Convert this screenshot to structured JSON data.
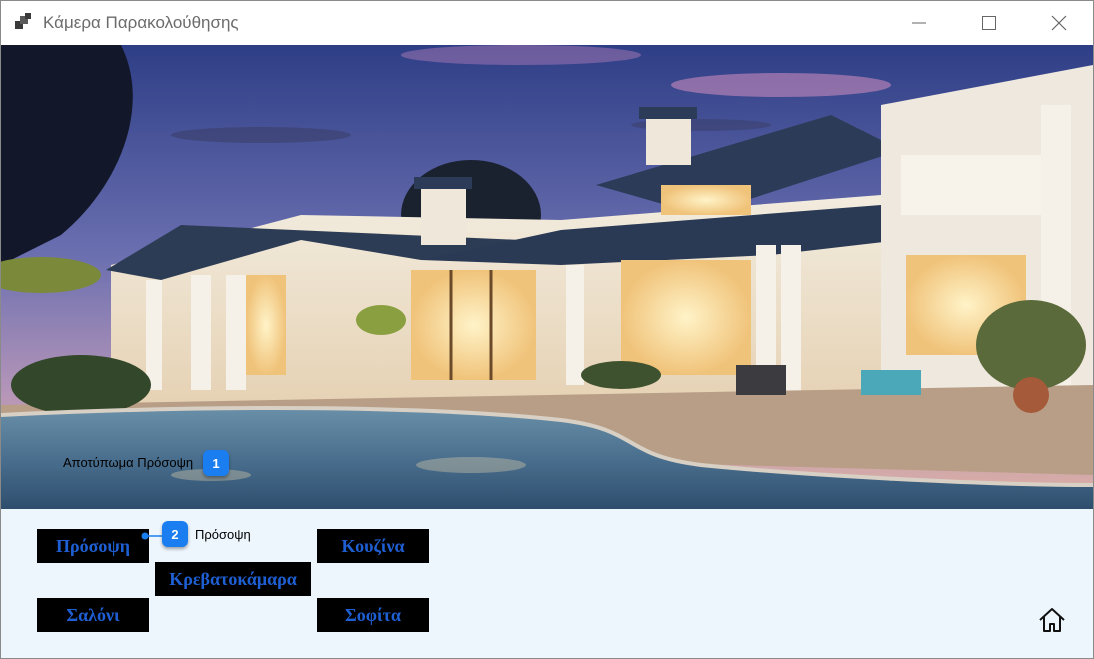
{
  "window": {
    "title": "Κάμερα Παρακολούθησης",
    "controls": {
      "minimize_icon": "minimize-icon",
      "maximize_icon": "maximize-icon",
      "close_icon": "close-icon"
    }
  },
  "camera_view": {
    "description_icon": "house-pool-photo",
    "annotation": {
      "label": "Αποτύπωμα Πρόσοψη",
      "badge": "1"
    }
  },
  "rooms": {
    "facade": "Πρόσοψη",
    "bedroom": "Κρεβατοκάμαρα",
    "kitchen": "Κουζίνα",
    "living": "Σαλόνι",
    "attic": "Σοφίτα",
    "button_bg": "#000000",
    "button_text_color": "#1f5fd4"
  },
  "facade_annotation": {
    "label": "Πρόσοψη",
    "badge": "2"
  },
  "home_icon": "home-icon",
  "colors": {
    "badge": "#1a7ef0",
    "panel_bg": "#eef6fd"
  }
}
